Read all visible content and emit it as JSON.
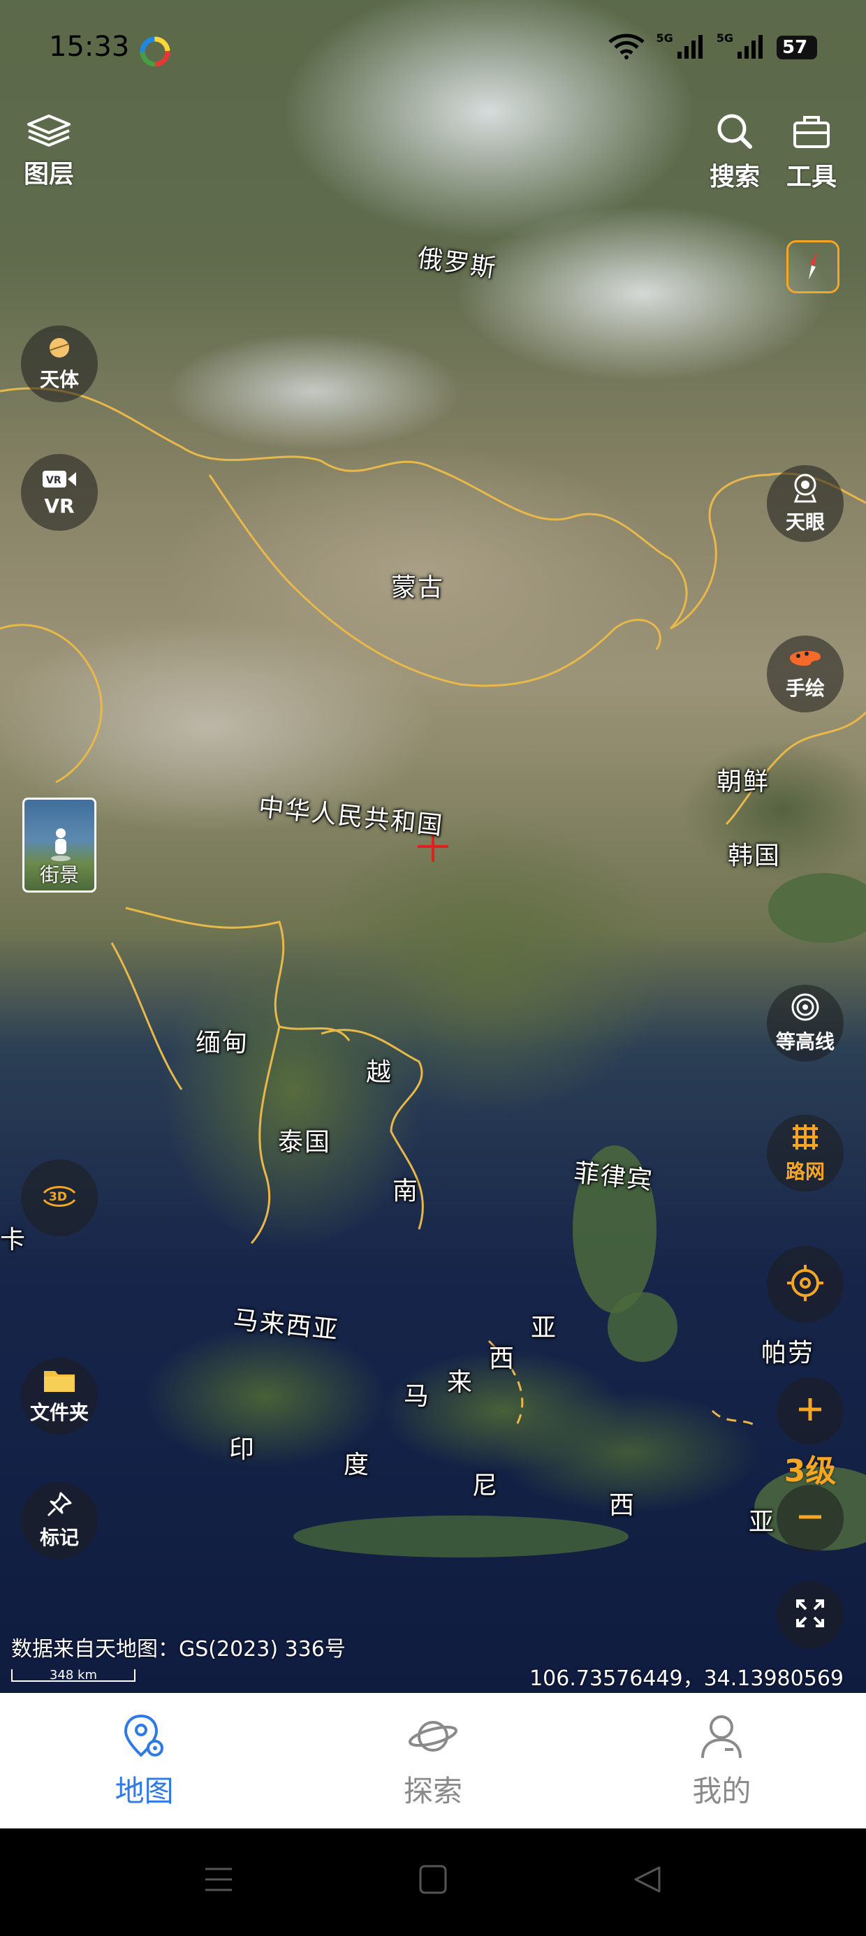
{
  "status_bar": {
    "time": "15:33",
    "network_1": "5G",
    "network_2": "5G",
    "battery": "57"
  },
  "top_buttons": {
    "layers": "图层",
    "search": "搜索",
    "tools": "工具"
  },
  "left_controls": {
    "celestial": "天体",
    "vr": "VR",
    "street_view": "街景",
    "three_d": "3D",
    "folder": "文件夹",
    "mark": "标记"
  },
  "right_controls": {
    "sky_eye": "天眼",
    "hand_draw": "手绘",
    "contour": "等高线",
    "road_network": "路网",
    "zoom_level": "3级"
  },
  "map_labels": {
    "russia": "俄罗斯",
    "mongolia": "蒙古",
    "china": "中华人民共和国",
    "north_korea": "朝鲜",
    "south_korea": "韩国",
    "myanmar": "缅甸",
    "vietnam_1": "越",
    "vietnam_2": "南",
    "thailand": "泰国",
    "philippines": "菲律宾",
    "malaysia_west": "马来西亚",
    "malaysia_east_1": "马",
    "malaysia_east_2": "来",
    "malaysia_east_3": "西",
    "malaysia_east_4": "亚",
    "indonesia_1": "印",
    "indonesia_2": "度",
    "indonesia_3": "尼",
    "indonesia_4": "西",
    "indonesia_5": "亚",
    "palau": "帕劳",
    "srilanka_fragment": "卡"
  },
  "map_info": {
    "attribution": "数据来自天地图：GS(2023) 336号",
    "scale": "348 km",
    "coordinates": "106.73576449，34.13980569"
  },
  "bottom_nav": {
    "map": "地图",
    "explore": "探索",
    "mine": "我的",
    "active_color": "#2f7ae5",
    "inactive_color": "#8a8a8a"
  },
  "colors": {
    "accent_orange": "#f5a623",
    "border_line": "#e8b84a"
  }
}
